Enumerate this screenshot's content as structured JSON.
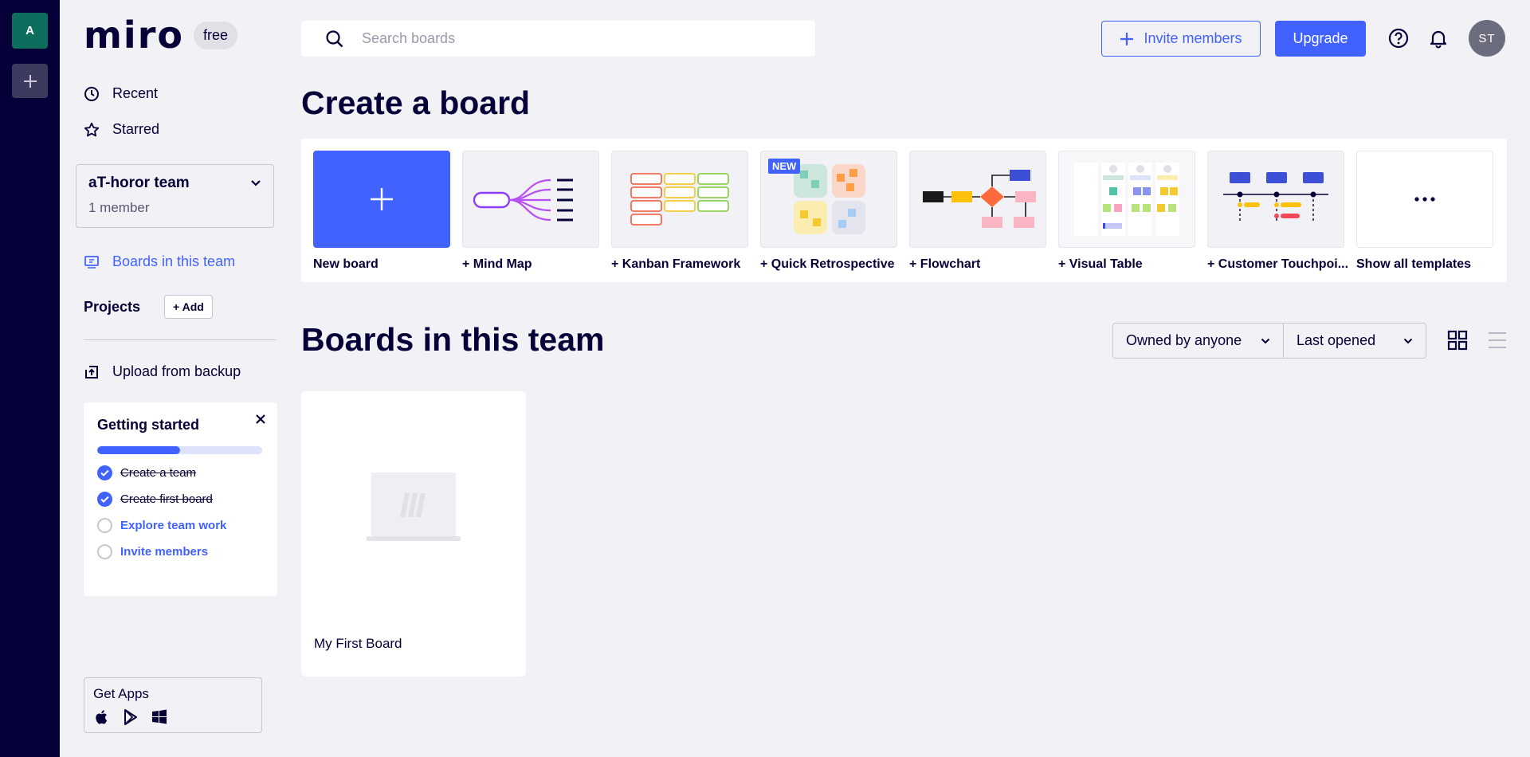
{
  "rail": {
    "team_initial": "A"
  },
  "sidebar": {
    "logo": "miro",
    "plan": "free",
    "nav": [
      {
        "label": "Recent",
        "icon": "clock-icon"
      },
      {
        "label": "Starred",
        "icon": "star-icon"
      }
    ],
    "team": {
      "name": "aT-horor team",
      "members": "1 member"
    },
    "boards_link": "Boards in this team",
    "projects_label": "Projects",
    "add_project": "+ Add",
    "upload": "Upload from backup",
    "getting_started": {
      "title": "Getting started",
      "progress": 0.5,
      "items": [
        {
          "label": "Create a team",
          "done": true
        },
        {
          "label": "Create first board",
          "done": true
        },
        {
          "label": "Explore team work",
          "done": false
        },
        {
          "label": "Invite members",
          "done": false
        }
      ]
    },
    "get_apps": "Get Apps"
  },
  "header": {
    "search_placeholder": "Search boards",
    "invite_label": "Invite members",
    "upgrade_label": "Upgrade",
    "user_initials": "ST"
  },
  "create": {
    "title": "Create a board",
    "templates": [
      {
        "label": "New board"
      },
      {
        "label": "+ Mind Map"
      },
      {
        "label": "+ Kanban Framework"
      },
      {
        "label": "+ Quick Retrospective",
        "badge": "NEW"
      },
      {
        "label": "+ Flowchart"
      },
      {
        "label": "+ Visual Table"
      },
      {
        "label": "+ Customer Touchpoi..."
      },
      {
        "label": "Show all templates"
      }
    ]
  },
  "boards": {
    "title": "Boards in this team",
    "owner_filter": "Owned by anyone",
    "sort": "Last opened",
    "items": [
      {
        "name": "My First Board"
      }
    ]
  },
  "colors": {
    "brand": "#4262ff",
    "navy": "#050038",
    "background": "#f2f1f5"
  }
}
